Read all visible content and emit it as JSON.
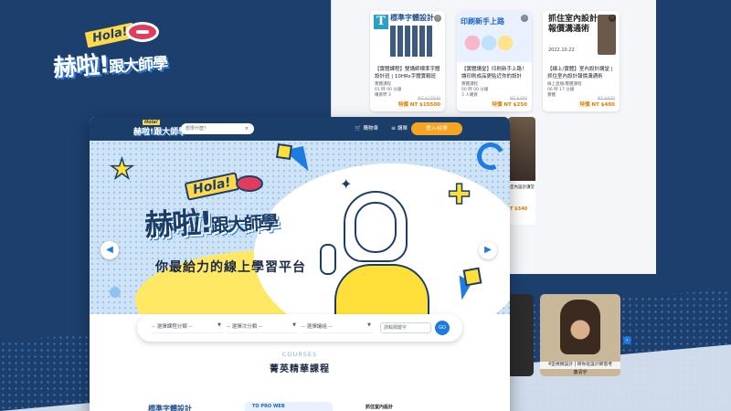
{
  "brand": {
    "hola": "Hola!",
    "name_main": "赫啦!",
    "name_sub": "跟大師學"
  },
  "back_listing": {
    "cards": [
      {
        "thumb_title": "標準字體設計",
        "title": "【實體課程】雙講師標準字體設計班 | 10HRs字體實戰班",
        "meta": [
          "實體課程",
          "01 時 00 分鐘",
          "購買學 3"
        ],
        "orig_price": "NT $17000",
        "price": "特價 NT $15500"
      },
      {
        "thumb_title": "印刷新手上路",
        "title": "【實體講堂】印刷新手上路！讓印刷成品更貼近你的設計",
        "meta": [
          "實體課程",
          "00 時 00 分鐘",
          "3 人購買"
        ],
        "orig_price": "NT $300",
        "price": "特價 NT $250"
      },
      {
        "thumb_title": "抓住室內設計報價溝通術",
        "thumb_sub": "2022.10.22",
        "title": "【線上/實體】室內設計講堂 | 抓住室內設計報價溝通術",
        "meta": [
          "線上直播/實體課程",
          "06 時 17 分鐘",
          "實體"
        ],
        "orig_price": "NT $600",
        "price": "特價 NT $400"
      }
    ],
    "side_card": {
      "title": "室內設計講堂",
      "price": "T $340"
    },
    "teacher_card": {
      "caption": "4堂視頻設計 | 帶你從設計師思考",
      "name": "蕭清宇"
    }
  },
  "nav": {
    "search_placeholder": "想學什麼？",
    "search_icon": "search-icon",
    "cart_label": "購物車",
    "chat_label": "講單",
    "login_label": "登入/註冊"
  },
  "hero": {
    "tagline": "你最給力的線上學習平台"
  },
  "filter": {
    "select1": "-- 選擇課程分類 --",
    "select2": "-- 選擇次分類 --",
    "select3": "-- 選擇議組 --",
    "keyword_placeholder": "請輸關鍵字",
    "go_label": "GO"
  },
  "courses": {
    "en": "COURSES",
    "zh": "菁英精華課程",
    "peek": [
      "標準字體設計",
      "TO PRO WEB",
      "抓住室內設計"
    ]
  },
  "colors": {
    "brand_navy": "#1b3d6a",
    "accent_blue": "#1e7be0",
    "accent_yellow": "#ffe03a",
    "login_orange": "#f5a524"
  }
}
